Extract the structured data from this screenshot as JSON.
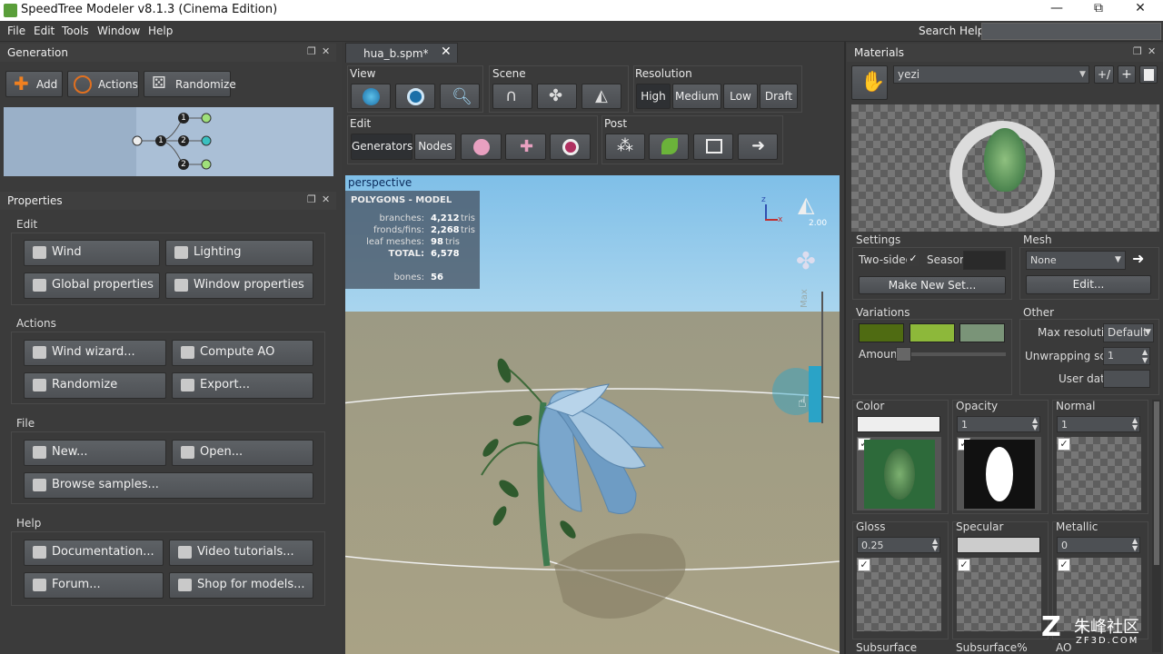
{
  "window": {
    "title": "SpeedTree Modeler v8.1.3 (Cinema Edition)",
    "min": "—",
    "max": "⧉",
    "close": "✕"
  },
  "menu": [
    "File",
    "Edit",
    "Tools",
    "Window",
    "Help"
  ],
  "search": {
    "label": "Search Help:",
    "value": ""
  },
  "generation": {
    "title": "Generation",
    "buttons": {
      "add": "Add",
      "actions": "Actions",
      "randomize": "Randomize"
    },
    "graph_numbers": [
      "1",
      "1",
      "2",
      "2"
    ]
  },
  "properties": {
    "title": "Properties",
    "sections": {
      "edit": {
        "label": "Edit",
        "wind": "Wind",
        "lighting": "Lighting",
        "global": "Global properties",
        "window": "Window properties"
      },
      "actions": {
        "label": "Actions",
        "wind_wizard": "Wind wizard...",
        "compute_ao": "Compute AO",
        "randomize": "Randomize",
        "export": "Export..."
      },
      "file": {
        "label": "File",
        "new": "New...",
        "open": "Open...",
        "browse": "Browse samples..."
      },
      "help": {
        "label": "Help",
        "docs": "Documentation...",
        "video": "Video tutorials...",
        "forum": "Forum...",
        "shop": "Shop for models..."
      }
    }
  },
  "doc_tab": {
    "label": "hua_b.spm*",
    "close": "✕"
  },
  "toolbar": {
    "view": "View",
    "scene": "Scene",
    "resolution": "Resolution",
    "res_options": [
      "High",
      "Medium",
      "Low",
      "Draft"
    ],
    "edit": "Edit",
    "generators": "Generators",
    "nodes": "Nodes",
    "post": "Post"
  },
  "viewport": {
    "camera": "perspective",
    "stats_title": "POLYGONS - MODEL",
    "stats": [
      {
        "label": "branches:",
        "value": "4,212",
        "unit": "tris"
      },
      {
        "label": "fronds/fins:",
        "value": "2,268",
        "unit": "tris"
      },
      {
        "label": "leaf meshes:",
        "value": "98",
        "unit": "tris"
      },
      {
        "label": "TOTAL:",
        "value": "6,578",
        "unit": ""
      }
    ],
    "bones_label": "bones:",
    "bones_value": "56",
    "light_value": "2.00",
    "wind_max": "Max",
    "axis_z": "z",
    "axis_x": "x"
  },
  "materials": {
    "title": "Materials",
    "selected": "yezi",
    "btn_swap": "+/",
    "btn_add": "+",
    "settings_label": "Settings",
    "two_sided": "Two-sided",
    "season": "Season",
    "make_new_set": "Make New Set...",
    "mesh_label": "Mesh",
    "mesh_value": "None",
    "edit_btn": "Edit...",
    "variations_label": "Variations",
    "amount_label": "Amount",
    "amount_value": 0,
    "variation_colors": [
      "#4f6b12",
      "#8db83a",
      "#7a9478"
    ],
    "other_label": "Other",
    "max_res_label": "Max resolution",
    "max_res_value": "Default",
    "unwrap_label": "Unwrapping scale",
    "unwrap_value": "1",
    "user_data_label": "User data",
    "user_data_value": "",
    "channels": {
      "color": "Color",
      "opacity": "Opacity",
      "opacity_value": "1",
      "normal": "Normal",
      "normal_value": "1",
      "gloss": "Gloss",
      "gloss_value": "0.25",
      "specular": "Specular",
      "metallic": "Metallic",
      "metallic_value": "0",
      "subsurface": "Subsurface",
      "subsurface_pct": "Subsurface%",
      "ao": "AO"
    }
  },
  "watermark": {
    "brand": "朱峰社区",
    "site": "ZF3D.COM"
  },
  "colors": {
    "sky": "#9ccbe9",
    "ground": "#a49e82",
    "accent_blue": "#2aa3c7"
  }
}
